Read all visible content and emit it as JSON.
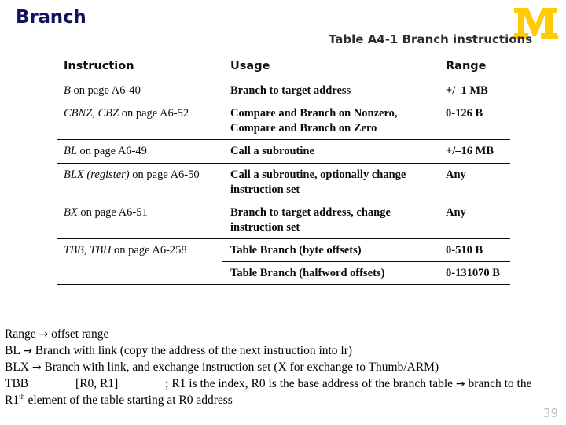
{
  "slide": {
    "title": "Branch",
    "title_color": "#13125c",
    "page_number": "39",
    "logo_color": "#FFCB05",
    "logo_letter": "M"
  },
  "table": {
    "caption": "Table A4-1 Branch instructions",
    "headers": {
      "instruction": "Instruction",
      "usage": "Usage",
      "range": "Range"
    },
    "rows": [
      {
        "instruction_italic": "B",
        "instruction_rest": " on page A6-40",
        "usage_lines": [
          "Branch to target address"
        ],
        "range": "+/–1 MB"
      },
      {
        "instruction_italic": "CBNZ, CBZ",
        "instruction_rest": " on page A6-52",
        "usage_lines": [
          "Compare and Branch on Nonzero,",
          "Compare and Branch on Zero"
        ],
        "range": "0-126 B"
      },
      {
        "instruction_italic": "BL",
        "instruction_rest": " on page A6-49",
        "usage_lines": [
          "Call a subroutine"
        ],
        "range": "+/–16 MB"
      },
      {
        "instruction_italic": "BLX (register)",
        "instruction_rest": " on page A6-50",
        "usage_lines": [
          "Call a subroutine, optionally change",
          "instruction set"
        ],
        "range": "Any"
      },
      {
        "instruction_italic": "BX",
        "instruction_rest": " on page A6-51",
        "usage_lines": [
          "Branch to target address, change",
          "instruction set"
        ],
        "range": "Any"
      },
      {
        "instruction_italic": "TBB, TBH",
        "instruction_rest": " on page A6-258",
        "usage_lines": [
          "Table Branch (byte offsets)"
        ],
        "range": "0-510 B"
      },
      {
        "instruction_italic": "",
        "instruction_rest": "",
        "usage_lines": [
          "Table Branch (halfword offsets)"
        ],
        "range": "0-131070 B"
      }
    ]
  },
  "notes": {
    "line1_a": "Range",
    "line1_b": "offset range",
    "line2_a": "BL",
    "line2_b": "Branch with link (copy the address of the next instruction into lr)",
    "line3_a": "BLX",
    "line3_b": "Branch with link, and exchange instruction set (X for exchange to Thumb/ARM)",
    "line4_a": "TBB",
    "line4_b": "[R0, R1]",
    "line4_c": "; R1 is the index, R0 is the base address of the branch table",
    "line4_d": "branch to the",
    "line5_a": "R1",
    "line5_sup": "th",
    "line5_b": " element of the table starting at R0 address",
    "arrow": "→"
  }
}
